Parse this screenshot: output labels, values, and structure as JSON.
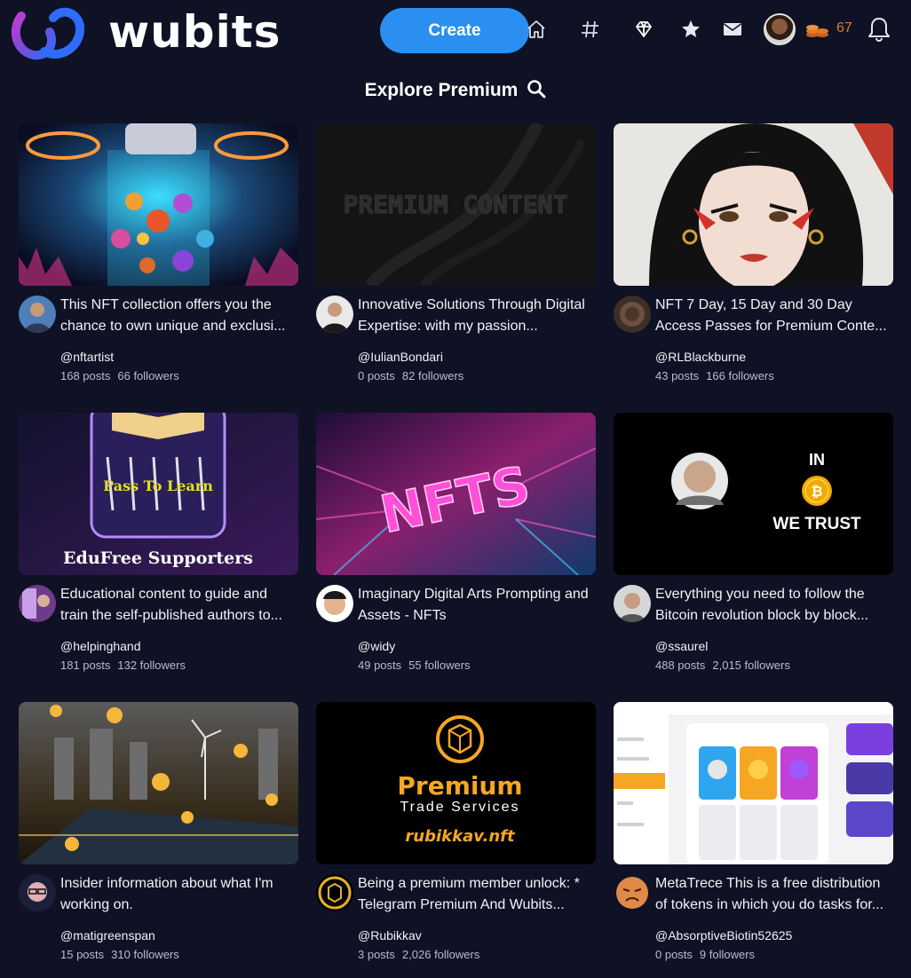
{
  "header": {
    "brand": "wubits",
    "create_label": "Create",
    "coins": "67",
    "icons": [
      "home-icon",
      "hashtag-icon",
      "diamond-icon",
      "star-icon",
      "mail-icon",
      "bell-icon"
    ]
  },
  "page": {
    "title": "Explore Premium"
  },
  "cards": [
    {
      "title": "This NFT collection offers you the chance to own unique and exclusi...",
      "handle": "@nftartist",
      "posts": "168 posts",
      "followers": "66 followers",
      "thumb": "nft-lab"
    },
    {
      "title": "Innovative Solutions Through Digital Expertise: with my passion...",
      "handle": "@IulianBondari",
      "posts": "0 posts",
      "followers": "82 followers",
      "thumb": "premium-content",
      "thumb_text": "PREMIUM CONTENT"
    },
    {
      "title": "NFT 7 Day, 15 Day and 30 Day Access Passes for Premium Conte...",
      "handle": "@RLBlackburne",
      "posts": "43 posts",
      "followers": "166 followers",
      "thumb": "portrait"
    },
    {
      "title": "Educational content to guide and train the self-published authors to...",
      "handle": "@helpinghand",
      "posts": "181 posts",
      "followers": "132 followers",
      "thumb": "edufree",
      "thumb_text": "Pass To Learn",
      "thumb_caption": "EduFree Supporters"
    },
    {
      "title": "Imaginary Digital Arts Prompting and Assets - NFTs",
      "handle": "@widy",
      "posts": "49 posts",
      "followers": "55 followers",
      "thumb": "nfts-neon",
      "thumb_text": "NFTS"
    },
    {
      "title": "Everything you need to follow the Bitcoin revolution block by block...",
      "handle": "@ssaurel",
      "posts": "488 posts",
      "followers": "2,015 followers",
      "thumb": "bitcoin-trust",
      "thumb_text_top": "IN",
      "thumb_text_bottom": "WE TRUST"
    },
    {
      "title": "Insider information about what I'm working on.",
      "handle": "@matigreenspan",
      "posts": "15 posts",
      "followers": "310 followers",
      "thumb": "energy"
    },
    {
      "title": "Being a premium member unlock: * Telegram Premium And Wubits...",
      "handle": "@Rubikkav",
      "posts": "3 posts",
      "followers": "2,026 followers",
      "thumb": "premium-trade",
      "thumb_text": "Premium",
      "thumb_sub": "Trade Services",
      "thumb_url": "rubikkav.nft"
    },
    {
      "title": "MetaTrece This is a free distribution of tokens in which you do tasks for...",
      "handle": "@AbsorptiveBiotin52625",
      "posts": "0 posts",
      "followers": "9 followers",
      "thumb": "app-screenshot"
    }
  ],
  "colors": {
    "background": "#0f1224",
    "accent": "#2a8ff0",
    "coins": "#e07a2c",
    "muted": "#b8bccb"
  }
}
